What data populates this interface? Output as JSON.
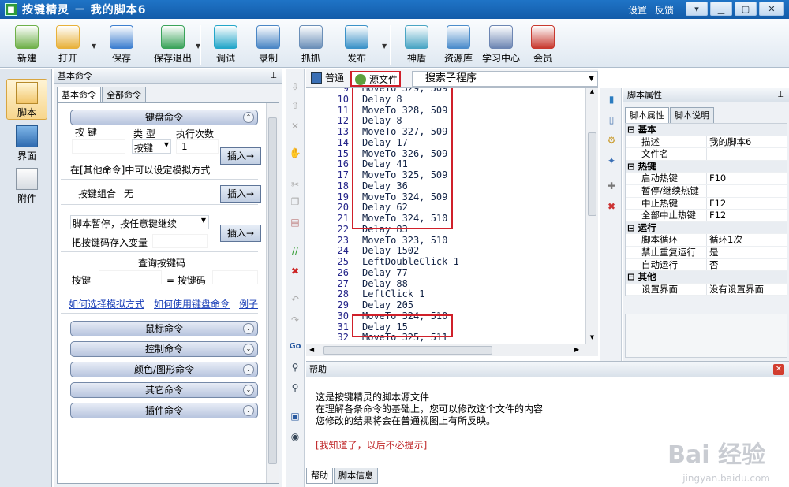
{
  "window": {
    "title": "按键精灵 － 我的脚本6",
    "links": [
      "设置",
      "反馈"
    ],
    "controls": [
      "▾",
      "▁",
      "▢",
      "✕"
    ]
  },
  "toolbar": {
    "items": [
      {
        "label": "新建",
        "icon": "new-file-icon",
        "color": "#6fb04a"
      },
      {
        "label": "打开",
        "icon": "open-folder-icon",
        "color": "#e8b13a"
      },
      {
        "label": "保存",
        "icon": "save-icon",
        "color": "#3d7fd0"
      },
      {
        "label": "保存退出",
        "icon": "save-exit-icon",
        "color": "#3aa35a"
      },
      {
        "label": "调试",
        "icon": "debug-icon",
        "color": "#23a6c9"
      },
      {
        "label": "录制",
        "icon": "record-icon",
        "color": "#4a86c5"
      },
      {
        "label": "抓抓",
        "icon": "grab-icon",
        "color": "#6b8fb8"
      },
      {
        "label": "发布",
        "icon": "publish-icon",
        "color": "#3b92c8"
      },
      {
        "label": "神盾",
        "icon": "shield-icon",
        "color": "#4aa5c4"
      },
      {
        "label": "资源库",
        "icon": "library-icon",
        "color": "#4b8ccb"
      },
      {
        "label": "学习中心",
        "icon": "learn-icon",
        "color": "#6d86b3"
      },
      {
        "label": "会员",
        "icon": "member-icon",
        "color": "#c8392f"
      }
    ]
  },
  "leftnav": {
    "items": [
      {
        "label": "脚本",
        "icon": "script-icon",
        "selected": true
      },
      {
        "label": "界面",
        "icon": "ui-icon",
        "selected": false
      },
      {
        "label": "附件",
        "icon": "attachment-icon",
        "selected": false
      }
    ]
  },
  "cmdpanel": {
    "title": "基本命令",
    "tabs": [
      "基本命令",
      "全部命令"
    ],
    "keyboard_group": "键盘命令",
    "col_key": "按 键",
    "col_type": "类 型",
    "col_times": "执行次数",
    "type_value": "按键",
    "times_value": "1",
    "insert_label": "插入→",
    "hint": "在[其他命令]中可以设定模拟方式",
    "combo_label": "按键组合",
    "combo_value": "无",
    "pause_option": "脚本暂停，按任意键继续",
    "save_var": "把按键码存入变量",
    "query_title": "查询按键码",
    "query_key": "按键",
    "query_code": "= 按键码",
    "links": [
      "如何选择模拟方式",
      "如何使用键盘命令",
      "例子"
    ],
    "groups": [
      "鼠标命令",
      "控制命令",
      "颜色/图形命令",
      "其它命令",
      "插件命令"
    ]
  },
  "editor": {
    "view_normal": "普通",
    "view_source": "源文件",
    "search_placeholder": "搜索子程序",
    "lines": [
      {
        "n": "9",
        "t": "MoveTo 329, 509"
      },
      {
        "n": "10",
        "t": "Delay 8"
      },
      {
        "n": "11",
        "t": "MoveTo 328, 509"
      },
      {
        "n": "12",
        "t": "Delay 8"
      },
      {
        "n": "13",
        "t": "MoveTo 327, 509"
      },
      {
        "n": "14",
        "t": "Delay 17"
      },
      {
        "n": "15",
        "t": "MoveTo 326, 509"
      },
      {
        "n": "16",
        "t": "Delay 41"
      },
      {
        "n": "17",
        "t": "MoveTo 325, 509"
      },
      {
        "n": "18",
        "t": "Delay 36"
      },
      {
        "n": "19",
        "t": "MoveTo 324, 509"
      },
      {
        "n": "20",
        "t": "Delay 62"
      },
      {
        "n": "21",
        "t": "MoveTo 324, 510"
      },
      {
        "n": "22",
        "t": "Delay 83"
      },
      {
        "n": "23",
        "t": "MoveTo 323, 510"
      },
      {
        "n": "24",
        "t": "Delay 1502"
      },
      {
        "n": "25",
        "t": "LeftDoubleClick 1"
      },
      {
        "n": "26",
        "t": "Delay 77"
      },
      {
        "n": "27",
        "t": "Delay 88"
      },
      {
        "n": "28",
        "t": "LeftClick 1"
      },
      {
        "n": "29",
        "t": "Delay 205"
      },
      {
        "n": "30",
        "t": "MoveTo 324, 510"
      },
      {
        "n": "31",
        "t": "Delay 15"
      },
      {
        "n": "32",
        "t": "MoveTo 325, 511"
      }
    ]
  },
  "help": {
    "title": "帮助",
    "line1": "这是按键精灵的脚本源文件",
    "line2": "在理解各条命令的基础上，您可以修改这个文件的内容",
    "line3": "您修改的结果将会在普通视图上有所反映。",
    "dismiss": "[我知道了，以后不必提示]",
    "tabs": [
      "帮助",
      "脚本信息"
    ],
    "dismiss_color": "#c0282a"
  },
  "props": {
    "title": "脚本属性",
    "tabs": [
      "脚本属性",
      "脚本说明"
    ],
    "rows": [
      {
        "cat": "基本"
      },
      {
        "k": "描述",
        "v": "我的脚本6"
      },
      {
        "k": "文件名",
        "v": ""
      },
      {
        "cat": "热键"
      },
      {
        "k": "启动热键",
        "v": "F10"
      },
      {
        "k": "暂停/继续热键",
        "v": ""
      },
      {
        "k": "中止热键",
        "v": "F12"
      },
      {
        "k": "全部中止热键",
        "v": "F12"
      },
      {
        "cat": "运行"
      },
      {
        "k": "脚本循环",
        "v": "循环1次"
      },
      {
        "k": "禁止重复运行",
        "v": "是"
      },
      {
        "k": "自动运行",
        "v": "否"
      },
      {
        "cat": "其他"
      },
      {
        "k": "设置界面",
        "v": "没有设置界面"
      }
    ]
  },
  "watermark": {
    "main": "Bai 经验",
    "sub": "jingyan.baidu.com"
  }
}
